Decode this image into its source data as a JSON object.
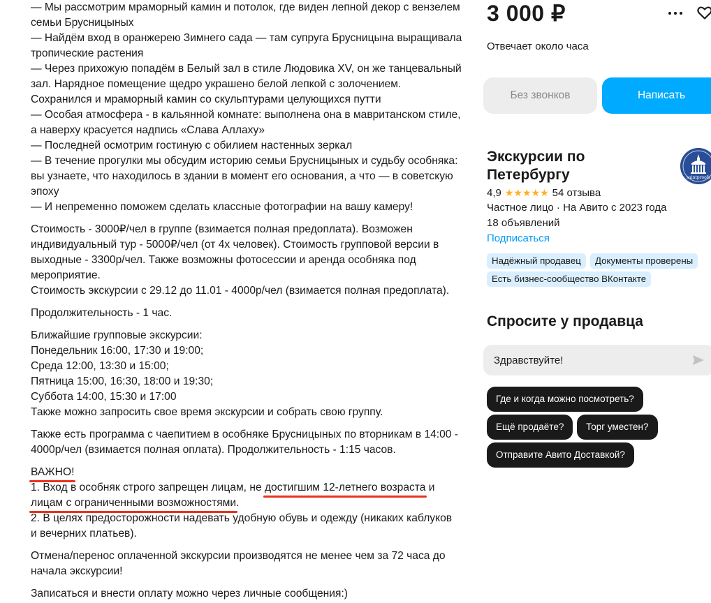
{
  "description": {
    "list_lines": [
      "— Мы рассмотрим мраморный камин и потолок, где виден лепной декор с вензелем",
      "семьи Брусницыных",
      "— Найдём вход в оранжерею Зимнего сада — там супруга Брусницына выращивала",
      "тропические растения",
      "— Через прихожую попадём в Белый зал в стиле Людовика XV, он же танцевальный",
      "зал. Нарядное помещение щедро украшено белой лепкой с золочением.",
      "Сохранился и мраморный камин со скульптурами целующихся путти",
      "— Особая атмосфера - в кальянной комнате: выполнена она в мавританском стиле,",
      "а наверху красуется надпись «Слава Аллаху»",
      "— Последней осмотрим гостиную с обилием настенных зеркал",
      "— В течение прогулки мы обсудим историю семьи Брусницыных и судьбу особняка:",
      "вы узнаете, что находилось в здании в момент его основания, а что — в советскую",
      "эпоху",
      "— И непременно поможем сделать классные фотографии на вашу камеру!"
    ],
    "cost_lines": [
      "Стоимость - 3000₽/чел в группе (взимается полная предоплата). Возможен",
      "индивидуальный тур - 5000₽/чел (от 4х человек). Стоимость групповой версии в",
      "выходные - 3300р/чел. Также возможны фотосессии и аренда особняка под",
      "мероприятие.",
      "Стоимость экскурсии с 29.12 до 11.01 - 4000р/чел (взимается полная предоплата)."
    ],
    "duration": "Продолжительность - 1 час.",
    "schedule_lines": [
      "Ближайшие групповые экскурсии:",
      "Понедельник 16:00, 17:30 и 19:00;",
      "Среда 12:00, 13:30 и 15:00;",
      "Пятница 15:00, 16:30, 18:00 и 19:30;",
      "Суббота 14:00, 15:30 и 17:00",
      "Также можно запросить свое время экскурсии и собрать свою группу."
    ],
    "tea_lines": [
      "Также есть программа с чаепитием в особняке Брусницыных по вторникам в 14:00 -",
      "4000р/чел (взимается полная оплата). Продолжительность - 1:15 часов."
    ],
    "important_title": "ВАЖНО!",
    "rule1_part1": "1. Вход в особняк строго запрещен лицам, не ",
    "rule1_highlight1": "достигшим 12-летнего возраста",
    "rule1_part2": " и",
    "rule1_highlight2": "лицам с ограниченными возможностями",
    "rule1_part3": ".",
    "rule2_lines": [
      "2. В целях предосторожности надевать удобную обувь и одежду (никаких каблуков",
      "и вечерних платьев)."
    ],
    "cancel_lines": [
      "Отмена/перенос оплаченной экскурсии производятся не менее чем за 72 часа до",
      "начала экскурсии!"
    ],
    "booking": "Записаться и внести оплату можно через личные сообщения:)"
  },
  "sidebar": {
    "price": "3 000 ₽",
    "reply_time": "Отвечает около часа",
    "no_calls_label": "Без звонков",
    "write_label": "Написать",
    "seller_name": "Экскурсии по Петербургу",
    "avatar_text": "saintproofs",
    "rating": "4,9",
    "stars": "★★★★★",
    "reviews": "54 отзыва",
    "seller_type": "Частное лицо · На Авито с 2023 года",
    "ads_count": "18 объявлений",
    "subscribe": "Подписаться",
    "badges": [
      "Надёжный продавец",
      "Документы проверены",
      "Есть бизнес-сообщество ВКонтакте"
    ]
  },
  "ask": {
    "title": "Спросите у продавца",
    "input_value": "Здравствуйте!",
    "quick_questions": [
      "Где и когда можно посмотреть?",
      "Ещё продаёте?",
      "Торг уместен?",
      "Отправите Авито Доставкой?"
    ]
  },
  "colors": {
    "accent_blue": "#00aaff",
    "link_blue": "#0099f7",
    "star_yellow": "#ffb021",
    "badge_blue": "#d9efff",
    "underline_red": "#e8321e"
  }
}
